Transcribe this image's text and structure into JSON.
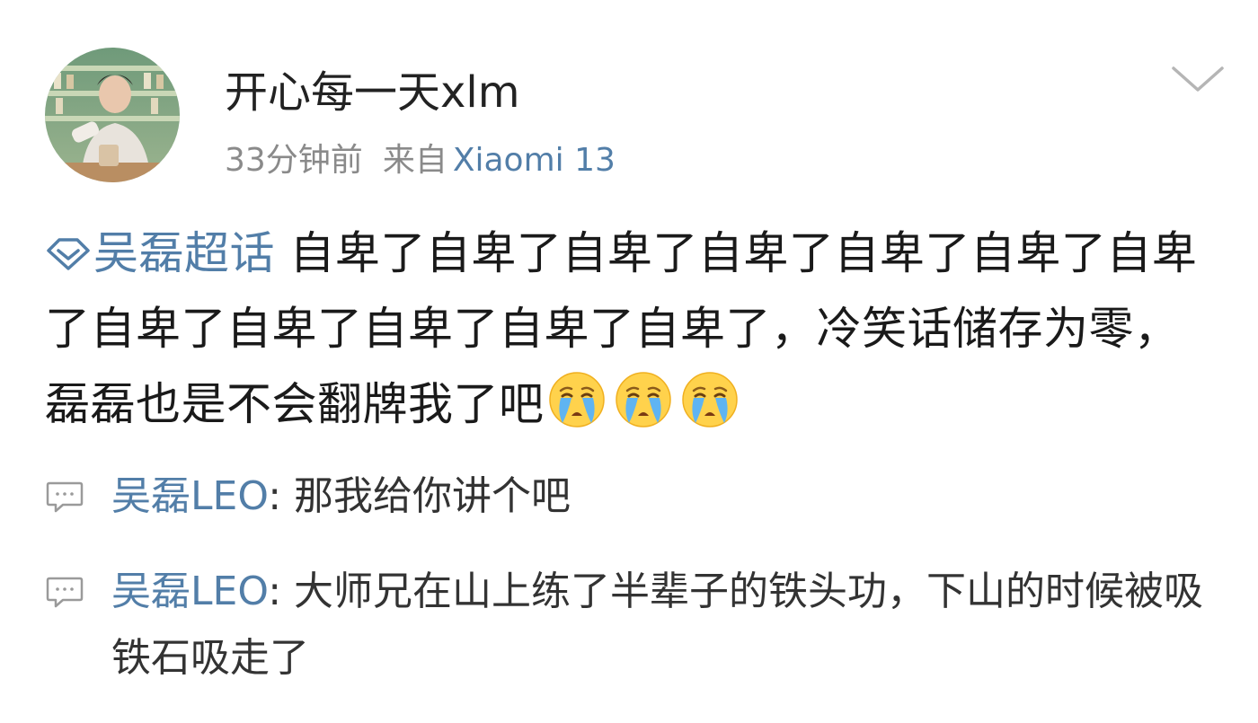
{
  "post": {
    "username": "开心每一天xlm",
    "time": "33分钟前",
    "from_label": "来自",
    "device": "Xiaomi 13",
    "topic": "吴磊超话",
    "content": "自卑了自卑了自卑了自卑了自卑了自卑了自卑了自卑了自卑了自卑了自卑了自卑了，冷笑话储存为零，磊磊也是不会翻牌我了吧",
    "emojis": [
      "crying-emoji",
      "crying-emoji",
      "crying-emoji"
    ]
  },
  "comments": [
    {
      "author": "吴磊LEO",
      "separator": ": ",
      "text": "那我给你讲个吧"
    },
    {
      "author": "吴磊LEO",
      "separator": ": ",
      "text": "大师兄在山上练了半辈子的铁头功，下山的时候被吸铁石吸走了"
    }
  ],
  "colors": {
    "link": "#527ea8",
    "meta": "#8a8a8a",
    "text": "#1a1a1a"
  }
}
